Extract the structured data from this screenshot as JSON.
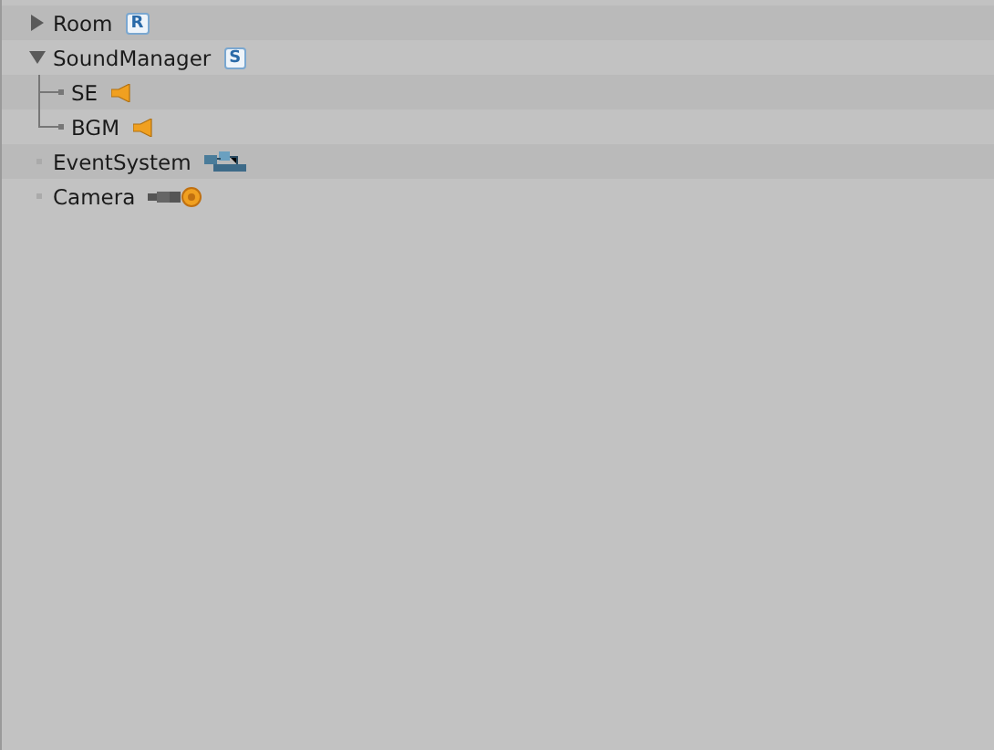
{
  "hierarchy": [
    {
      "name": "Room",
      "kind": "badge",
      "badge": "R",
      "expanded": false
    },
    {
      "name": "SoundManager",
      "kind": "badge",
      "badge": "S",
      "expanded": true,
      "children": [
        {
          "name": "SE",
          "kind": "audio"
        },
        {
          "name": "BGM",
          "kind": "audio"
        }
      ]
    },
    {
      "name": "EventSystem",
      "kind": "eventsystem"
    },
    {
      "name": "Camera",
      "kind": "camera"
    }
  ]
}
